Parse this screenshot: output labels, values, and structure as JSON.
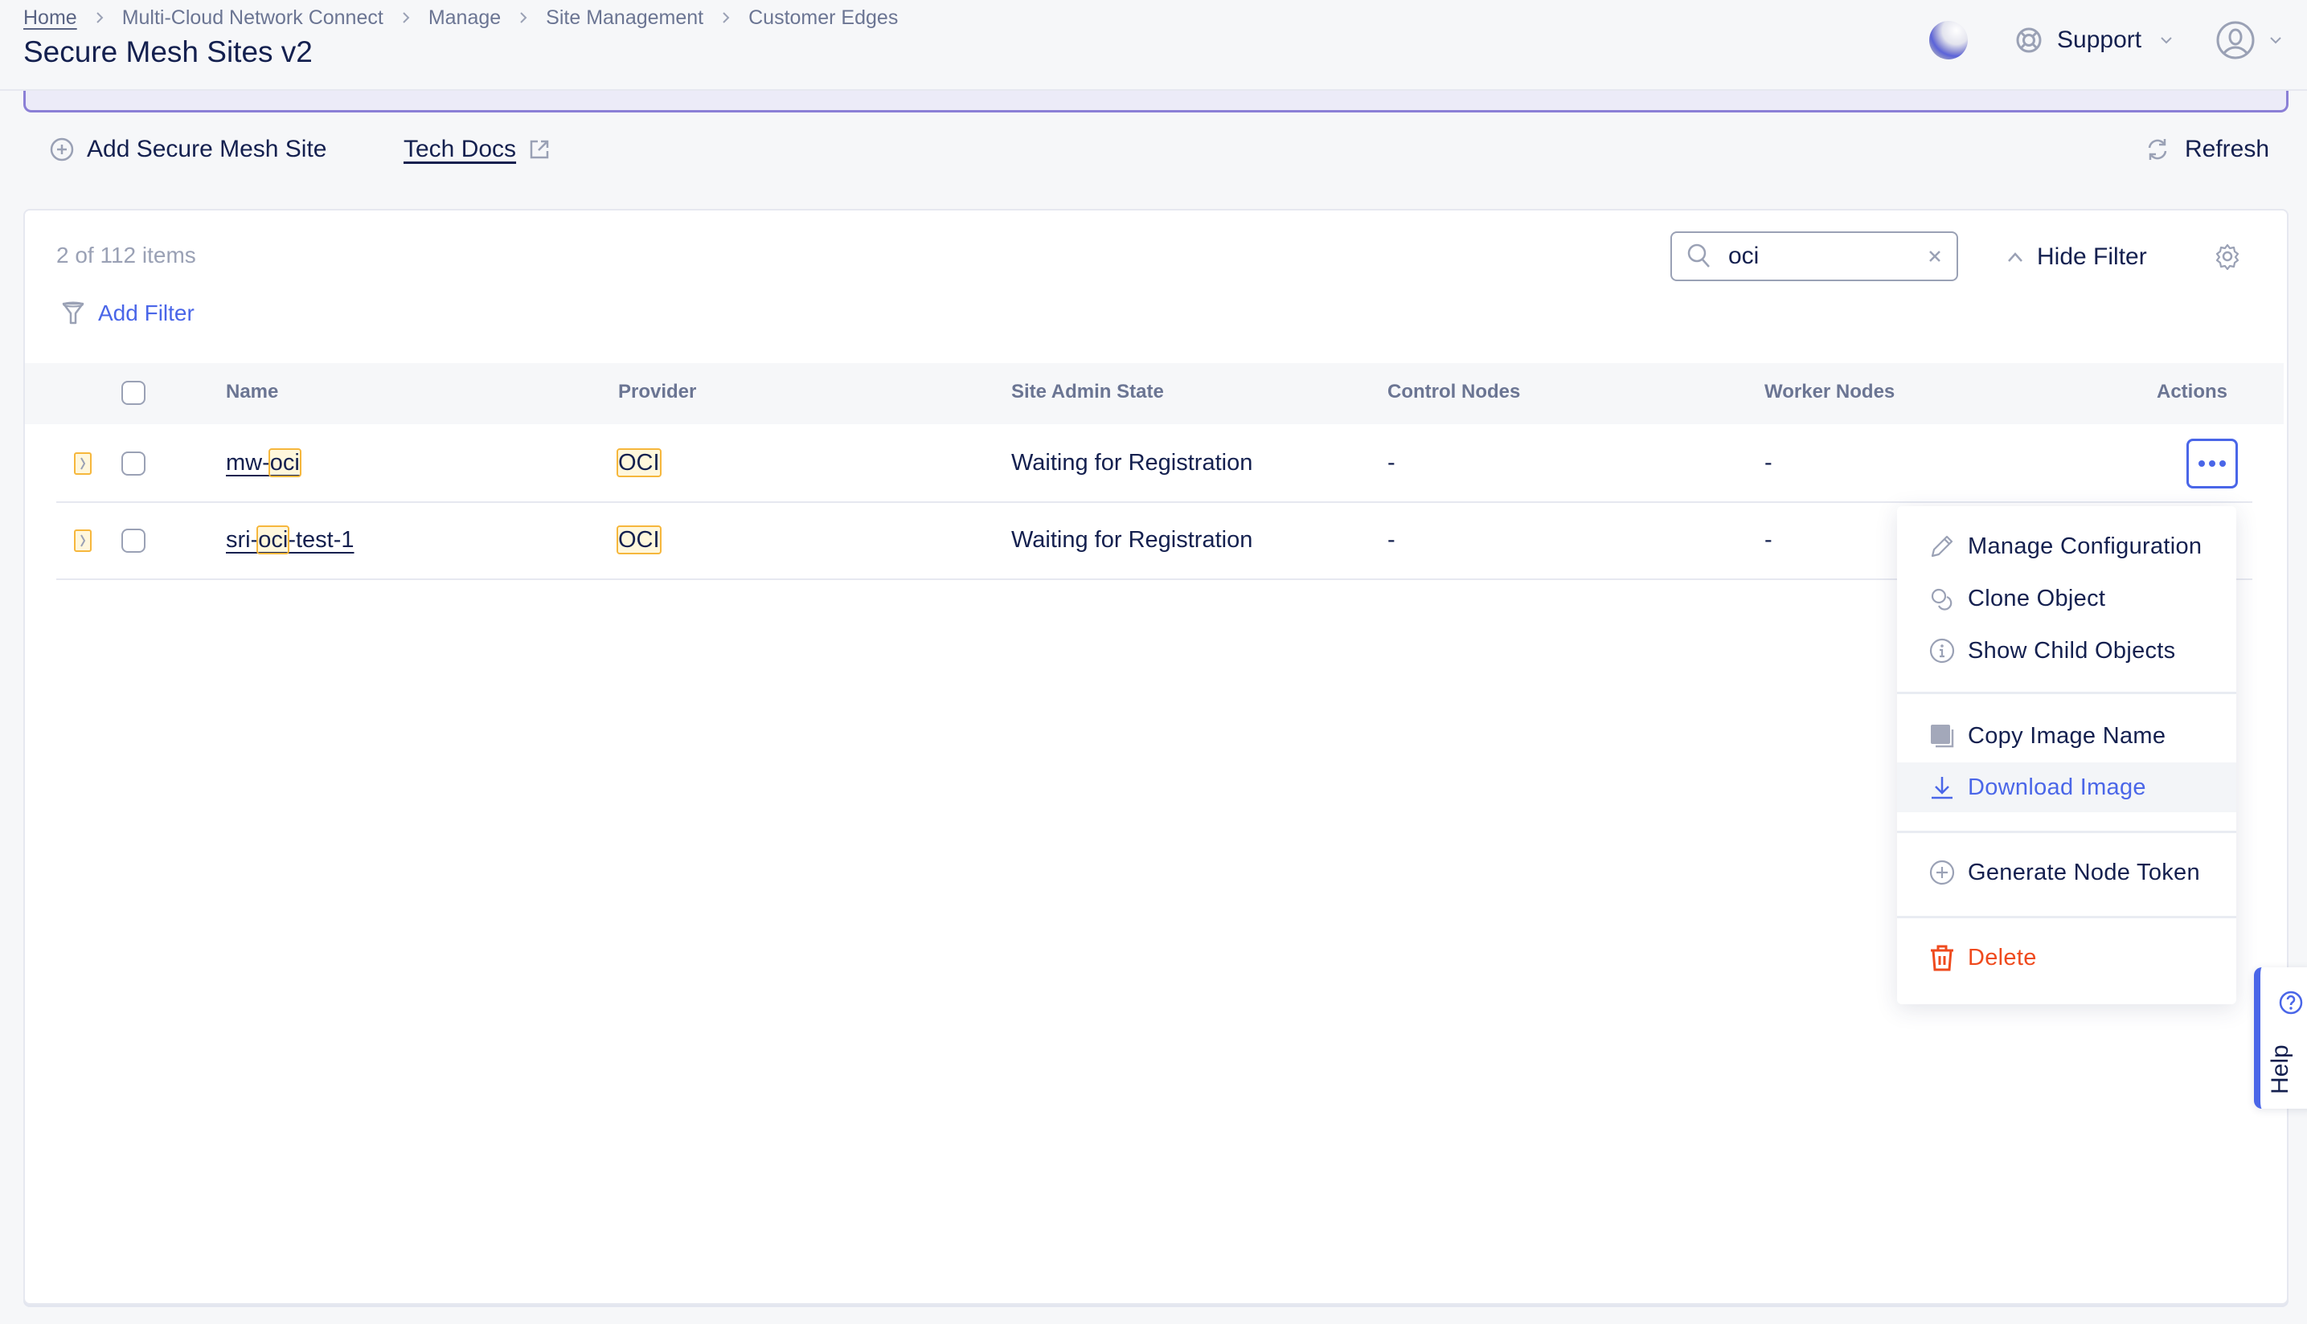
{
  "header": {
    "breadcrumb": [
      "Home",
      "Multi-Cloud Network Connect",
      "Manage",
      "Site Management",
      "Customer Edges"
    ],
    "title": "Secure Mesh Sites v2",
    "support_label": "Support"
  },
  "toolbar": {
    "add_label": "Add Secure Mesh Site",
    "tech_docs_label": "Tech Docs",
    "refresh_label": "Refresh"
  },
  "list": {
    "count_text": "2 of 112 items",
    "add_filter_label": "Add Filter",
    "search_value": "oci",
    "search_placeholder": "Search",
    "hide_filter_label": "Hide Filter"
  },
  "table": {
    "columns": [
      "Name",
      "Provider",
      "Site Admin State",
      "Control Nodes",
      "Worker Nodes",
      "Actions"
    ],
    "rows": [
      {
        "name_pre": "mw-",
        "name_match": "oci",
        "name_post": "",
        "provider": "OCI",
        "state": "Waiting for Registration",
        "control_nodes": "-",
        "worker_nodes": "-"
      },
      {
        "name_pre": "sri-",
        "name_match": "oci",
        "name_post": "-test-1",
        "provider": "OCI",
        "state": "Waiting for Registration",
        "control_nodes": "-",
        "worker_nodes": "-"
      }
    ]
  },
  "actions_menu": {
    "items": [
      {
        "label": "Manage Configuration",
        "icon": "pencil-icon"
      },
      {
        "label": "Clone Object",
        "icon": "clone-icon"
      },
      {
        "label": "Show Child Objects",
        "icon": "info-icon"
      },
      {
        "label": "Copy Image Name",
        "icon": "copy-icon"
      },
      {
        "label": "Download Image",
        "icon": "download-icon",
        "state": "hovered"
      },
      {
        "label": "Generate Node Token",
        "icon": "plus-circle-icon"
      },
      {
        "label": "Delete",
        "icon": "trash-icon",
        "variant": "danger"
      }
    ]
  },
  "help": {
    "label": "Help"
  },
  "colors": {
    "accent": "#4a66e8",
    "text_primary": "#14204f",
    "text_muted": "#6b7593",
    "highlight_bg": "#fff7dc",
    "highlight_border": "#f6b73c",
    "danger": "#ef4a1d",
    "banner_border": "#8b7fd6"
  }
}
